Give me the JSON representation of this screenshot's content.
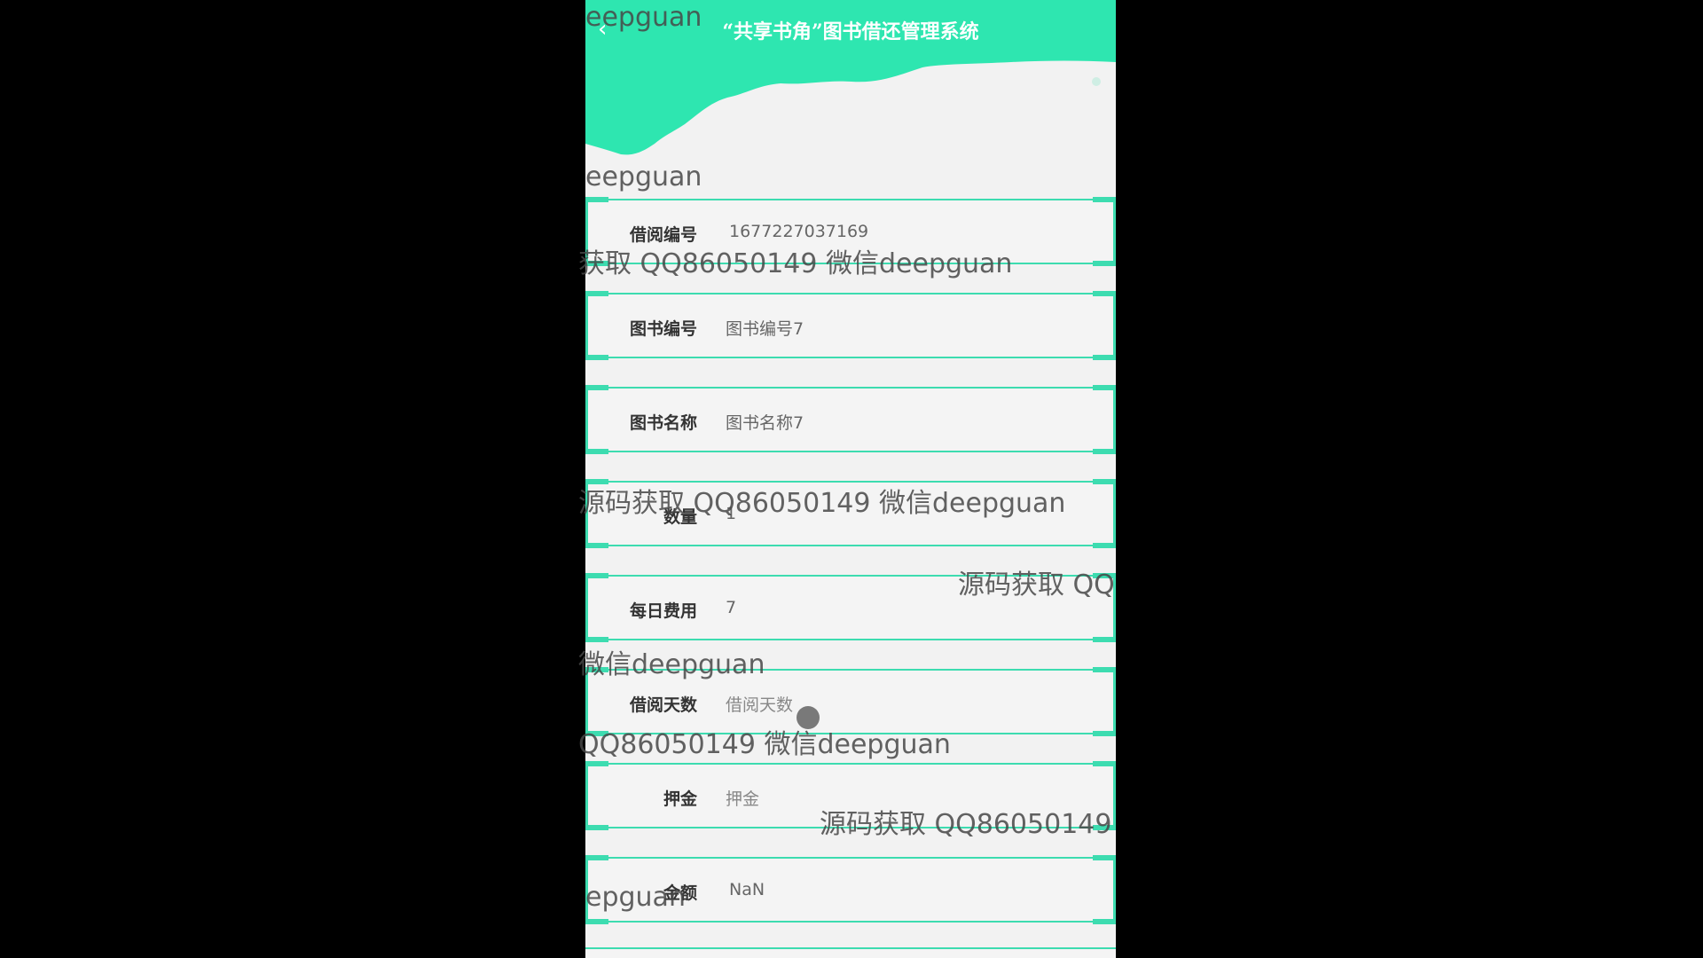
{
  "header": {
    "back_icon": "chevron-left-icon",
    "title": "“共享书角”图书借还管理系统"
  },
  "colors": {
    "accent": "#2ee6b0",
    "row_border": "#3ddcb0",
    "background": "#f2f2f2"
  },
  "form": {
    "rows": [
      {
        "label": "借阅编号",
        "value": "1677227037169"
      },
      {
        "label": "图书编号",
        "value": "图书编号7"
      },
      {
        "label": "图书名称",
        "value": "图书名称7"
      },
      {
        "label": "数量",
        "value": "1"
      },
      {
        "label": "每日费用",
        "value": "7"
      },
      {
        "label": "借阅天数",
        "value": "借阅天数"
      },
      {
        "label": "押金",
        "value": "押金"
      },
      {
        "label": "金额",
        "value": "NaN"
      }
    ]
  },
  "watermarks": [
    "eepguan",
    "eepguan",
    "获取 QQ86050149 微信deepguan",
    "源码获取 QQ86050149 微信deepguan",
    "源码获取 QQ",
    "微信deepguan",
    "QQ86050149 微信deepguan",
    "源码获取 QQ86050149",
    "epguan"
  ]
}
